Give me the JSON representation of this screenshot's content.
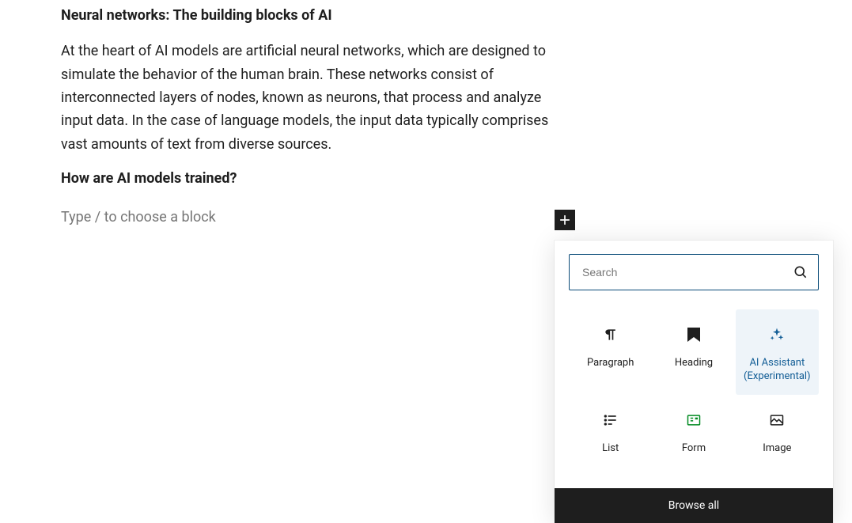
{
  "editor": {
    "heading1": "Neural networks: The building blocks of AI",
    "paragraph": "At the heart of AI models are artificial neural networks, which are designed to simulate the behavior of the human brain. These networks consist of interconnected layers of nodes, known as neurons, that process and analyze input data. In the case of language models, the input data typically comprises vast amounts of text from diverse sources.",
    "heading2": "How are AI models trained?",
    "new_block_placeholder": "Type / to choose a block"
  },
  "inserter": {
    "search_placeholder": "Search",
    "blocks": {
      "paragraph": "Paragraph",
      "heading": "Heading",
      "ai_assistant": "AI Assistant",
      "ai_assistant_sub": "(Experimental)",
      "list": "List",
      "form": "Form",
      "image": "Image"
    },
    "browse_all": "Browse all"
  }
}
